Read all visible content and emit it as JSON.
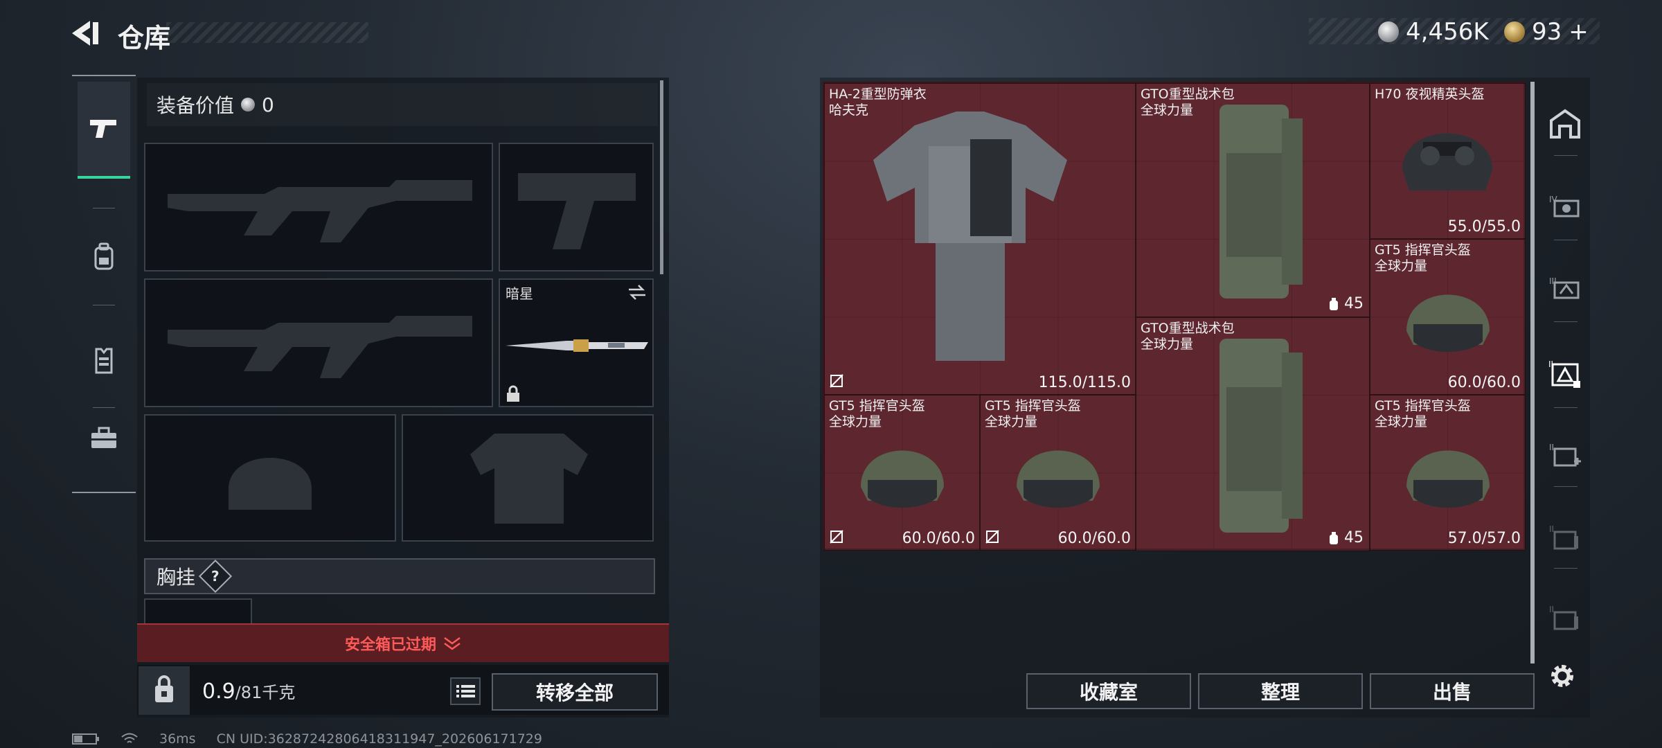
{
  "header": {
    "title": "仓库",
    "currency_silver": "4,456K",
    "currency_gold": "93",
    "currency_gold_plus": "+"
  },
  "leftnav": {
    "items": [
      "pistol-icon",
      "backpack-icon",
      "vest-icon",
      "toolbox-icon"
    ],
    "active_index": 0
  },
  "loadout": {
    "equip_value_label": "装备价值",
    "equip_value": "0",
    "melee_name": "暗星",
    "chest_rig_label": "胸挂",
    "chest_rig_help": "?",
    "safe_box_status": "安全箱已过期",
    "weight_value": "0.9",
    "weight_max": "/81千克",
    "transfer_all": "转移全部"
  },
  "stash": {
    "items": [
      {
        "name": "HA-2重型防弹衣",
        "sub": "哈夫克",
        "value": "115.0/115.0",
        "nodrop": true
      },
      {
        "name": "GTO重型战术包",
        "sub": "全球力量",
        "capacity": "45"
      },
      {
        "name": "H70 夜视精英头盔",
        "sub": "",
        "value": "55.0/55.0"
      },
      {
        "name": "GT5 指挥官头盔",
        "sub": "全球力量",
        "value": "60.0/60.0"
      },
      {
        "name": "GTO重型战术包",
        "sub": "全球力量",
        "capacity": "45"
      },
      {
        "name": "GT5 指挥官头盔",
        "sub": "全球力量",
        "value": "60.0/60.0",
        "nodrop": true
      },
      {
        "name": "GT5 指挥官头盔",
        "sub": "全球力量",
        "value": "60.0/60.0",
        "nodrop": true
      },
      {
        "name": "GT5 指挥官头盔",
        "sub": "全球力量",
        "value": "57.0/57.0"
      }
    ],
    "buttons": {
      "collection": "收藏室",
      "organize": "整理",
      "sell": "出售"
    }
  },
  "rightnav": {
    "items": [
      "stash-home-icon",
      "tab-iv-icon",
      "tab-iii-icon",
      "tab-ii-active-icon",
      "tab-add-icon",
      "tab-locked-1-icon",
      "tab-locked-2-icon"
    ],
    "settings": "gear-icon"
  },
  "status": {
    "ping": "36ms",
    "uid": "CN UID:3628724280641831194​7_202606171729"
  }
}
